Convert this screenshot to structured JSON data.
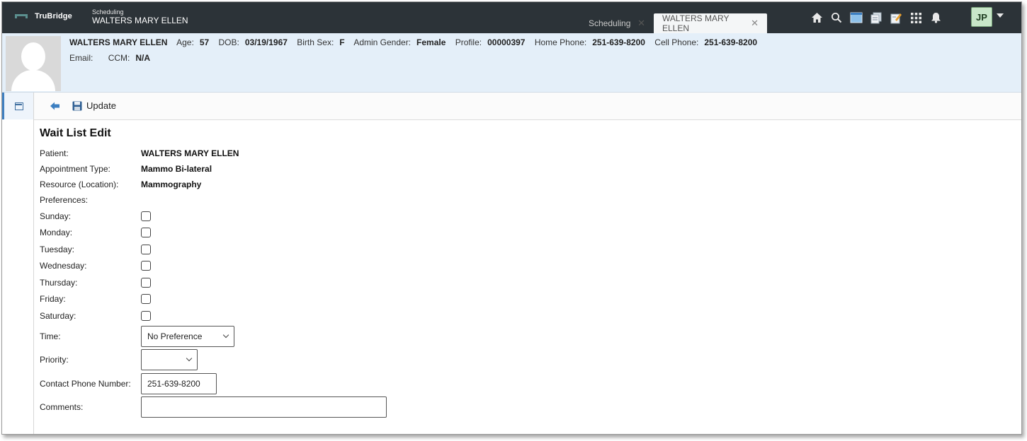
{
  "app": {
    "logo": "TruBridge",
    "module": "Scheduling",
    "patient_title": "WALTERS MARY ELLEN"
  },
  "tabs": [
    {
      "label": "Scheduling",
      "active": false
    },
    {
      "label": "WALTERS MARY ELLEN",
      "active": true
    }
  ],
  "toolbar_icons": [
    "home-icon",
    "search-icon",
    "window-icon",
    "documents-icon",
    "notes-icon",
    "apps-grid-icon",
    "bell-icon"
  ],
  "user": {
    "initials": "JP"
  },
  "patient": {
    "name": "WALTERS MARY ELLEN",
    "age_label": "Age:",
    "age": "57",
    "dob_label": "DOB:",
    "dob": "03/19/1967",
    "birth_sex_label": "Birth Sex:",
    "birth_sex": "F",
    "admin_gender_label": "Admin Gender:",
    "admin_gender": "Female",
    "profile_label": "Profile:",
    "profile": "00000397",
    "home_phone_label": "Home Phone:",
    "home_phone": "251-639-8200",
    "cell_phone_label": "Cell Phone:",
    "cell_phone": "251-639-8200",
    "email_label": "Email:",
    "email": "",
    "ccm_label": "CCM:",
    "ccm": "N/A"
  },
  "actions": {
    "update_label": "Update"
  },
  "form": {
    "title": "Wait List Edit",
    "patient_label": "Patient:",
    "patient_value": "WALTERS MARY ELLEN",
    "appt_type_label": "Appointment Type:",
    "appt_type_value": "Mammo Bi-lateral",
    "resource_label": "Resource (Location):",
    "resource_value": "Mammography",
    "preferences_label": "Preferences:",
    "days": [
      {
        "label": "Sunday:",
        "checked": false
      },
      {
        "label": "Monday:",
        "checked": false
      },
      {
        "label": "Tuesday:",
        "checked": false
      },
      {
        "label": "Wednesday:",
        "checked": false
      },
      {
        "label": "Thursday:",
        "checked": false
      },
      {
        "label": "Friday:",
        "checked": false
      },
      {
        "label": "Saturday:",
        "checked": false
      }
    ],
    "time_label": "Time:",
    "time_value": "No Preference",
    "priority_label": "Priority:",
    "priority_value": "",
    "contact_phone_label": "Contact Phone Number:",
    "contact_phone_value": "251-639-8200",
    "comments_label": "Comments:",
    "comments_value": ""
  },
  "colors": {
    "topbar": "#2c3338",
    "patient_header": "#e4eff9",
    "accent": "#3f7fc0",
    "avatar": "#c8e6c9"
  }
}
